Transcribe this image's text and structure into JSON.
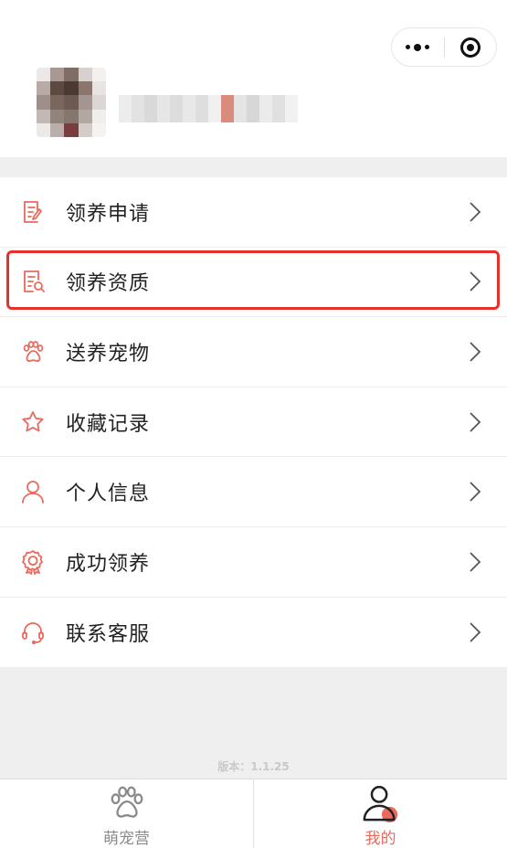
{
  "header": {
    "capsule": {
      "more_icon": "more-dots-icon",
      "close_icon": "target-icon"
    },
    "avatar_colors": [
      "#ebe8e6",
      "#a99791",
      "#7f6d66",
      "#d8d2cf",
      "#f2f1f0",
      "#b8aaa4",
      "#5d4940",
      "#4b3a33",
      "#8b766d",
      "#e7e4e2",
      "#9e9089",
      "#7a665e",
      "#6d5a52",
      "#a49590",
      "#dcd7d4",
      "#c2b8b4",
      "#93837d",
      "#857670",
      "#b3a7a2",
      "#f0eeed",
      "#ece9e7",
      "#b9aeaa",
      "#7b3c40",
      "#d3ccc9",
      "#f4f3f2"
    ],
    "name_colors": [
      "#ececec",
      "#e2e2e2",
      "#d9d9d9",
      "#e6e6e6",
      "#dcdcdc",
      "#e8e8e8",
      "#dedede",
      "#f0f0f0",
      "#d98b7d",
      "#e4e4e4",
      "#d7d7d7",
      "#ebebeb",
      "#e0e0e0",
      "#f1f1f1"
    ]
  },
  "accent_color": "#e96a5f",
  "highlight_color": "#e8302b",
  "menu": [
    {
      "label": "领养申请",
      "icon": "apply-form-icon"
    },
    {
      "label": "领养资质",
      "icon": "qualification-doc-icon"
    },
    {
      "label": "送养宠物",
      "icon": "paw-icon"
    },
    {
      "label": "收藏记录",
      "icon": "star-icon"
    },
    {
      "label": "个人信息",
      "icon": "person-icon"
    },
    {
      "label": "成功领养",
      "icon": "badge-icon"
    },
    {
      "label": "联系客服",
      "icon": "headset-icon"
    }
  ],
  "version": "版本：1.1.25",
  "tabs": [
    {
      "label": "萌宠营",
      "icon": "paw-tab-icon",
      "active": false
    },
    {
      "label": "我的",
      "icon": "user-tab-icon",
      "active": true
    }
  ]
}
